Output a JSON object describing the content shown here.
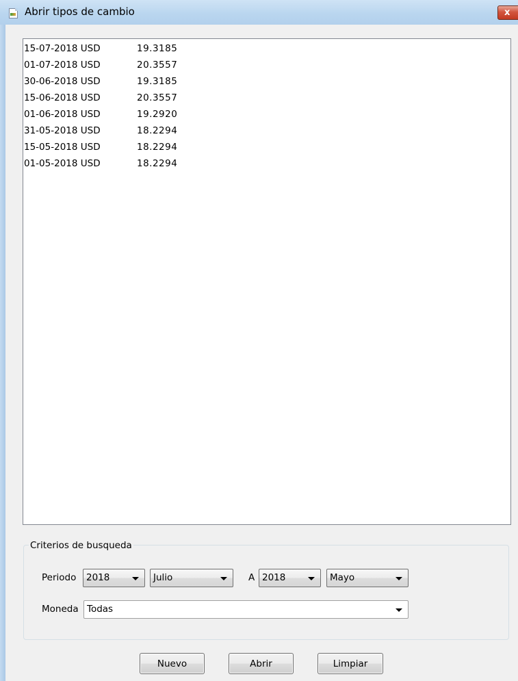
{
  "window": {
    "title": "Abrir tipos de cambio",
    "close_label": "x"
  },
  "list": {
    "rows": [
      {
        "date": "15-07-2018 USD",
        "value": "19.3185"
      },
      {
        "date": "01-07-2018 USD",
        "value": "20.3557"
      },
      {
        "date": "30-06-2018 USD",
        "value": "19.3185"
      },
      {
        "date": "15-06-2018 USD",
        "value": "20.3557"
      },
      {
        "date": "01-06-2018 USD",
        "value": "19.2920"
      },
      {
        "date": "31-05-2018 USD",
        "value": "18.2294"
      },
      {
        "date": "15-05-2018 USD",
        "value": "18.2294"
      },
      {
        "date": "01-05-2018 USD",
        "value": "18.2294"
      }
    ]
  },
  "criteria": {
    "legend": "Criterios de busqueda",
    "periodo_label": "Periodo",
    "periodo_year": "2018",
    "periodo_month": "Julio",
    "a_label": "A",
    "a_year": "2018",
    "a_month": "Mayo",
    "moneda_label": "Moneda",
    "moneda_value": "Todas"
  },
  "buttons": {
    "nuevo": "Nuevo",
    "abrir": "Abrir",
    "limpiar": "Limpiar"
  }
}
